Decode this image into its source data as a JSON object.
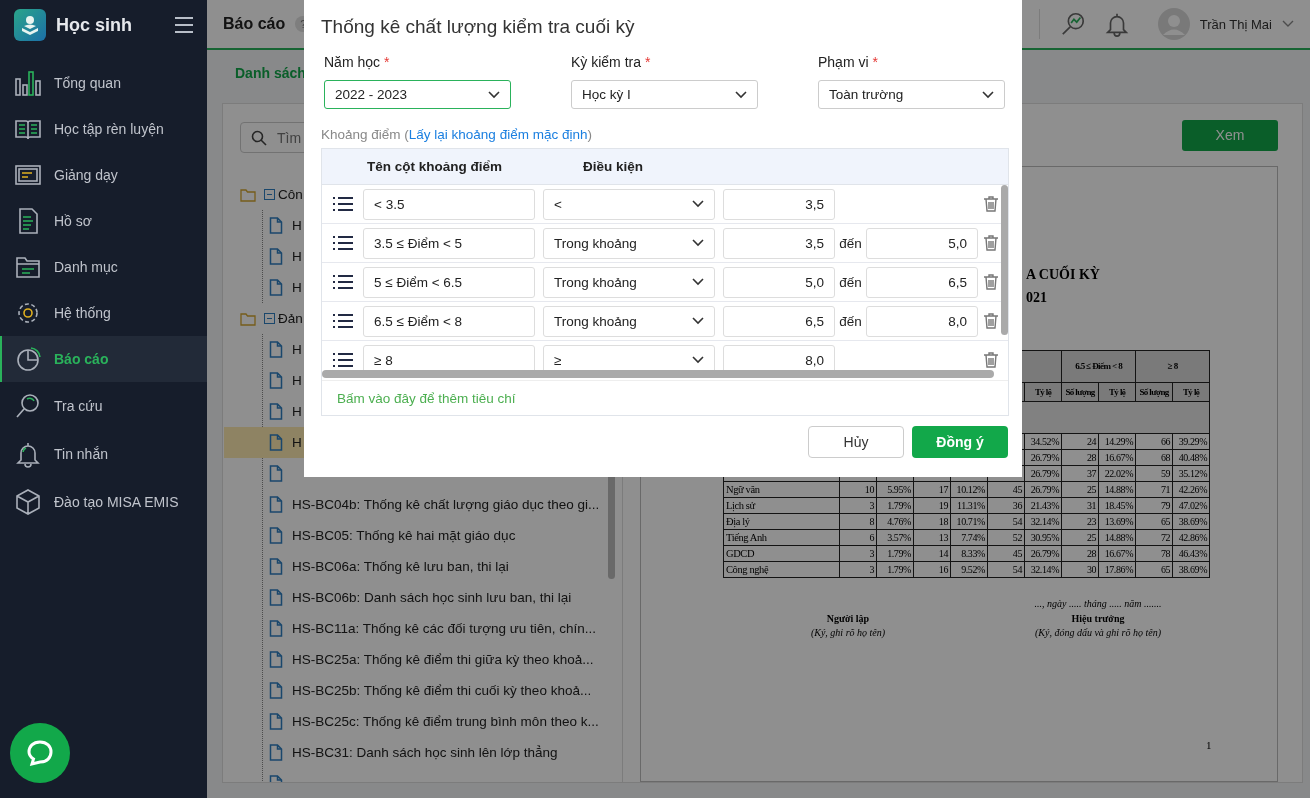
{
  "sidebar": {
    "app_title": "Học sinh",
    "items": [
      {
        "label": "Tổng quan",
        "selected": false
      },
      {
        "label": "Học tập rèn luyện",
        "selected": false
      },
      {
        "label": "Giảng dạy",
        "selected": false
      },
      {
        "label": "Hồ sơ",
        "selected": false
      },
      {
        "label": "Danh mục",
        "selected": false
      },
      {
        "label": "Hệ thống",
        "selected": false
      },
      {
        "label": "Báo cáo",
        "selected": true
      },
      {
        "label": "Tra cứu",
        "selected": false
      },
      {
        "label": "Tin nhắn",
        "selected": false
      },
      {
        "label": "Đào tạo MISA EMIS",
        "selected": false
      }
    ]
  },
  "header": {
    "title": "Báo cáo",
    "help": "?",
    "user": "Trần Thị Mai"
  },
  "tabs": [
    {
      "label": "Danh sách",
      "selected": true
    }
  ],
  "report_list": {
    "search_placeholder": "Tìm",
    "groups": [
      {
        "label": "Côn",
        "expanded": true,
        "children": [
          {
            "label": "H",
            "selected": false
          },
          {
            "label": "H",
            "selected": false
          },
          {
            "label": "H",
            "selected": false
          }
        ]
      },
      {
        "label": "Đản",
        "expanded": true,
        "children": [
          {
            "label": "H",
            "selected": false
          },
          {
            "label": "H",
            "selected": false
          },
          {
            "label": "H",
            "selected": false
          },
          {
            "label": "H",
            "selected": true
          },
          {
            "selected": false
          },
          {
            "label": "HS-BC04b: Thống kê chất lượng giáo dục theo gi...",
            "selected": false
          },
          {
            "label": "HS-BC05: Thống kê hai mặt giáo dục",
            "selected": false
          },
          {
            "label": "HS-BC06a: Thống kê lưu ban, thi lại",
            "selected": false
          },
          {
            "label": "HS-BC06b: Danh sách học sinh lưu ban, thi lại",
            "selected": false
          },
          {
            "label": "HS-BC11a: Thống kê các đối tượng ưu tiên, chín...",
            "selected": false
          },
          {
            "label": "HS-BC25a: Thống kê điểm thi giữa kỳ theo khoả...",
            "selected": false
          },
          {
            "label": "HS-BC25b: Thống kê điểm thi cuối kỳ theo khoả...",
            "selected": false
          },
          {
            "label": "HS-BC25c: Thống kê điểm trung bình môn theo k...",
            "selected": false
          },
          {
            "label": "HS-BC31: Danh sách học sinh lên lớp thẳng",
            "selected": false
          },
          {
            "selected": false
          }
        ]
      }
    ]
  },
  "preview": {
    "button": "Xem",
    "document": {
      "title_lines": [
        "A CUỐI KỲ",
        "021"
      ],
      "header_groups": [
        "6.5 ≤ Điểm < 8",
        "≥ 8"
      ],
      "subheaders": [
        "Tỷ lệ",
        "Số lượng",
        "Tỷ lệ",
        "Số lượng",
        "Tỷ lệ"
      ],
      "partial_rows": [
        [
          "34.52%",
          "24",
          "14.29%",
          "66",
          "39.29%"
        ],
        [
          "26.79%",
          "28",
          "16.67%",
          "68",
          "40.48%"
        ],
        [
          "26.79%",
          "37",
          "22.02%",
          "59",
          "35.12%"
        ]
      ],
      "rows": [
        [
          "Ngữ văn",
          "10",
          "5.95%",
          "17",
          "10.12%",
          "45",
          "26.79%",
          "25",
          "14.88%",
          "71",
          "42.26%"
        ],
        [
          "Lịch sử",
          "3",
          "1.79%",
          "19",
          "11.31%",
          "36",
          "21.43%",
          "31",
          "18.45%",
          "79",
          "47.02%"
        ],
        [
          "Địa lý",
          "8",
          "4.76%",
          "18",
          "10.71%",
          "54",
          "32.14%",
          "23",
          "13.69%",
          "65",
          "38.69%"
        ],
        [
          "Tiếng Anh",
          "6",
          "3.57%",
          "13",
          "7.74%",
          "52",
          "30.95%",
          "25",
          "14.88%",
          "72",
          "42.86%"
        ],
        [
          "GDCD",
          "3",
          "1.79%",
          "14",
          "8.33%",
          "45",
          "26.79%",
          "28",
          "16.67%",
          "78",
          "46.43%"
        ],
        [
          "Công nghệ",
          "3",
          "1.79%",
          "16",
          "9.52%",
          "54",
          "32.14%",
          "30",
          "17.86%",
          "65",
          "38.69%"
        ]
      ],
      "signatures": [
        {
          "role": "Người lập",
          "note": "(Ký, ghi rõ họ tên)"
        },
        {
          "date": "..., ngày ..... tháng ..... năm .......",
          "role": "Hiệu trưởng",
          "note": "(Ký, đóng dấu và ghi rõ họ tên)"
        }
      ],
      "page_number": "1"
    }
  },
  "dialog": {
    "title": "Thống kê chất lượng kiểm tra cuối kỳ",
    "fields": [
      {
        "label": "Năm học",
        "required_mark": "*",
        "value": "2022 - 2023",
        "focused": true
      },
      {
        "label": "Kỳ kiểm tra",
        "required_mark": "*",
        "value": "Học kỳ I",
        "focused": false
      },
      {
        "label": "Phạm vi",
        "required_mark": "*",
        "value": "Toàn trường",
        "focused": false
      }
    ],
    "range_caption": {
      "before": "Khoảng điểm (",
      "link": "Lấy lại khoảng điểm mặc định",
      "after": ")"
    },
    "columns": [
      "Tên cột khoảng điểm",
      "Điều kiện"
    ],
    "rows": [
      {
        "kind": "single",
        "name": "< 3.5",
        "condition": "<",
        "from": "3,5"
      },
      {
        "kind": "range",
        "name": "3.5 ≤ Điểm < 5",
        "condition": "Trong khoảng",
        "from": "3,5",
        "to_label": "đến",
        "to": "5,0"
      },
      {
        "kind": "range",
        "name": "5 ≤ Điểm < 6.5",
        "condition": "Trong khoảng",
        "from": "5,0",
        "to_label": "đến",
        "to": "6,5"
      },
      {
        "kind": "range",
        "name": "6.5 ≤ Điểm < 8",
        "condition": "Trong khoảng",
        "from": "6,5",
        "to_label": "đến",
        "to": "8,0"
      },
      {
        "kind": "single",
        "name": "≥ 8",
        "condition": "≥",
        "from": "8,0"
      }
    ],
    "add_hint": "Bấm vào đây để thêm tiêu chí",
    "buttons": [
      {
        "label": "Hủy",
        "kind": "secondary"
      },
      {
        "label": "Đồng ý",
        "kind": "primary"
      }
    ]
  }
}
